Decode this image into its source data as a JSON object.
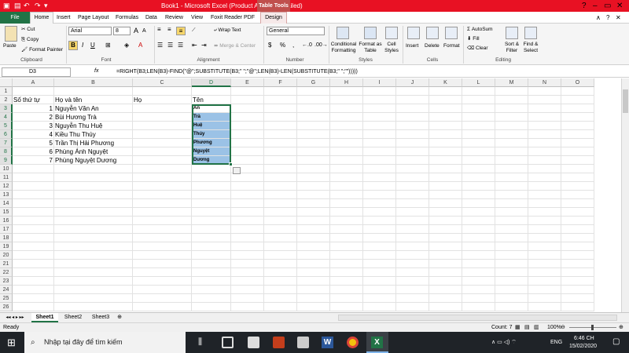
{
  "title_bar": {
    "title": "Book1 - Microsoft Excel (Product Activation Failed)",
    "contextual": "Table Tools"
  },
  "tabs": [
    "File",
    "Home",
    "Insert",
    "Page Layout",
    "Formulas",
    "Data",
    "Review",
    "View",
    "Foxit Reader PDF",
    "Design"
  ],
  "ribbon": {
    "paste": "Paste",
    "cut": "Cut",
    "copy": "Copy",
    "format_painter": "Format Painter",
    "font_name": "Arial",
    "font_size": "8",
    "wrap_text": "Wrap Text",
    "merge_center": "Merge & Center",
    "number_format": "General",
    "conditional_formatting": "Conditional Formatting",
    "format_as_table": "Format as Table",
    "cell_styles": "Cell Styles",
    "insert": "Insert",
    "delete": "Delete",
    "format": "Format",
    "autosum": "AutoSum",
    "fill": "Fill",
    "clear": "Clear",
    "sort_filter": "Sort & Filter",
    "find_select": "Find & Select",
    "groups": [
      "Clipboard",
      "Font",
      "Alignment",
      "Number",
      "Styles",
      "Cells",
      "Editing"
    ]
  },
  "formula_bar": {
    "name_box": "D3",
    "fx": "fx",
    "formula": "=RIGHT(B3;LEN(B3)-FIND(\"@\";SUBSTITUTE(B3;\" \";\"@\";LEN(B3)-LEN(SUBSTITUTE(B3;\" \";\"\")))))"
  },
  "columns": [
    "A",
    "B",
    "C",
    "D",
    "E",
    "F",
    "G",
    "H",
    "I",
    "J",
    "K",
    "L",
    "M",
    "N",
    "O"
  ],
  "rows": [
    "1",
    "2",
    "3",
    "4",
    "5",
    "6",
    "7",
    "8",
    "9",
    "10",
    "11",
    "12",
    "13",
    "14",
    "15",
    "16",
    "17",
    "18",
    "19",
    "20",
    "21",
    "22",
    "23",
    "24",
    "25",
    "26"
  ],
  "headers": {
    "a": "Số thứ tự",
    "b": "Họ và tên",
    "c": "Họ",
    "d": "Tên"
  },
  "data_rows": [
    {
      "stt": "1",
      "name": "Nguyễn Văn An",
      "last": "An"
    },
    {
      "stt": "2",
      "name": "Bùi Hương Trà",
      "last": "Trà"
    },
    {
      "stt": "3",
      "name": "Nguyễn Thu Huệ",
      "last": "Huệ"
    },
    {
      "stt": "4",
      "name": "Kiều Thu Thúy",
      "last": "Thúy"
    },
    {
      "stt": "5",
      "name": "Trần Thị Hải Phương",
      "last": "Phương"
    },
    {
      "stt": "6",
      "name": "Phùng Ánh Nguyệt",
      "last": "Nguyệt"
    },
    {
      "stt": "7",
      "name": "Phùng Nguyệt Dương",
      "last": "Dương"
    }
  ],
  "sheets": [
    "Sheet1",
    "Sheet2",
    "Sheet3"
  ],
  "status": {
    "ready": "Ready",
    "count": "Count: 7",
    "zoom": "100%"
  },
  "taskbar": {
    "search_placeholder": "Nhập tại đây để tìm kiếm",
    "language": "ENG",
    "time": "6:46 CH",
    "date": "15/02/2020"
  },
  "colors": {
    "accent": "#217346",
    "title": "#e81123",
    "selection": "#9bc2e6"
  }
}
